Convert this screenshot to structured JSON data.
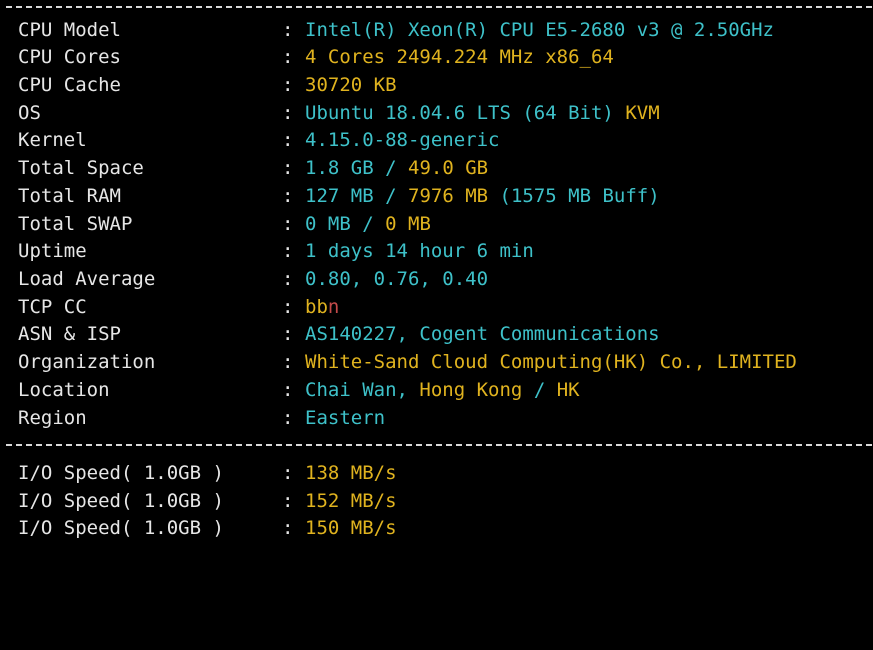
{
  "colors": {
    "background": "#000000",
    "label": "#e6e6e6",
    "cyan": "#3ec1c9",
    "yellow": "#e0b31f",
    "separator": "#d9d9d9"
  },
  "separator_char": "-",
  "colon": ":",
  "info": {
    "cpu_model": {
      "label": "CPU Model",
      "value": "Intel(R) Xeon(R) CPU E5-2680 v3 @ 2.50GHz"
    },
    "cpu_cores": {
      "label": "CPU Cores",
      "value": "4 Cores 2494.224 MHz x86_64"
    },
    "cpu_cache": {
      "label": "CPU Cache",
      "value": "30720 KB"
    },
    "os": {
      "label": "OS",
      "value": "Ubuntu 18.04.6 LTS (64 Bit)",
      "virt": "KVM"
    },
    "kernel": {
      "label": "Kernel",
      "value": "4.15.0-88-generic"
    },
    "total_space": {
      "label": "Total Space",
      "used": "1.8 GB",
      "slash": "/",
      "total": "49.0 GB"
    },
    "total_ram": {
      "label": "Total RAM",
      "used": "127 MB",
      "slash": "/",
      "total": "7976 MB",
      "buff": "(1575 MB Buff)"
    },
    "total_swap": {
      "label": "Total SWAP",
      "used": "0 MB",
      "slash": "/",
      "total": "0 MB"
    },
    "uptime": {
      "label": "Uptime",
      "value": "1 days 14 hour 6 min"
    },
    "load_average": {
      "label": "Load Average",
      "value": "0.80, 0.76, 0.40"
    },
    "tcp_cc": {
      "label": "TCP CC",
      "value": "bb",
      "cursor": "n"
    },
    "asn_isp": {
      "label": "ASN & ISP",
      "value": "AS140227, Cogent Communications"
    },
    "organization": {
      "label": "Organization",
      "value": "White-Sand Cloud Computing(HK) Co., LIMITED"
    },
    "location": {
      "label": "Location",
      "city": "Chai Wan, Hong Kong",
      "slash": "/",
      "country": "HK"
    },
    "region": {
      "label": "Region",
      "value": "Eastern"
    }
  },
  "io": [
    {
      "label": "I/O Speed( 1.0GB )",
      "value": "138 MB/s"
    },
    {
      "label": "I/O Speed( 1.0GB )",
      "value": "152 MB/s"
    },
    {
      "label": "I/O Speed( 1.0GB )",
      "value": "150 MB/s"
    }
  ]
}
